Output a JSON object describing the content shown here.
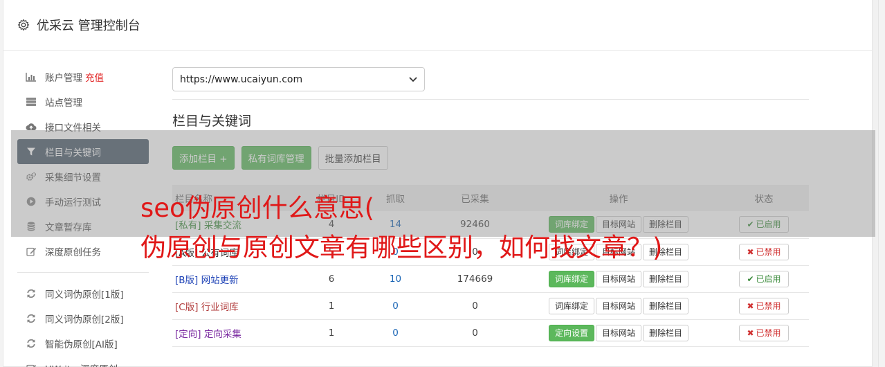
{
  "header": {
    "title": "优采云 管理控制台"
  },
  "sidebar": {
    "items": [
      {
        "label": "账户管理",
        "extra": "充值",
        "icon": "bar-chart-icon"
      },
      {
        "label": "站点管理",
        "icon": "server-icon"
      },
      {
        "label": "接口文件相关",
        "icon": "cloud-upload-icon"
      },
      {
        "label": "栏目与关键词",
        "icon": "filter-icon",
        "active": true
      },
      {
        "label": "采集细节设置",
        "icon": "cogs-icon"
      },
      {
        "label": "手动运行测试",
        "icon": "play-circle-icon"
      },
      {
        "label": "文章暂存库",
        "icon": "database-icon"
      },
      {
        "label": "深度原创任务",
        "icon": "edit-icon"
      }
    ],
    "items2": [
      {
        "label": "同义词伪原创[1版]",
        "icon": "refresh-icon"
      },
      {
        "label": "同义词伪原创[2版]",
        "icon": "refresh-icon"
      },
      {
        "label": "智能伪原创[AI版]",
        "icon": "refresh-icon"
      },
      {
        "label": "UWriter深度原创",
        "icon": "edit-icon"
      }
    ]
  },
  "main": {
    "site_select": "https://www.ucaiyun.com",
    "section_title": "栏目与关键词",
    "buttons": {
      "add": "添加栏目 +",
      "private_lib": "私有词库管理",
      "batch_add": "批量添加栏目"
    },
    "table": {
      "headers": [
        "栏目名称",
        "栏目ID",
        "抓取",
        "已采集",
        "操作",
        "状态"
      ],
      "rows": [
        {
          "tag": "[私有]",
          "name": "采集交流",
          "id": "4",
          "grab": "14",
          "collected": "92460",
          "bind": "词库绑定",
          "bind_green": true,
          "site": "目标网站",
          "del": "删除栏目",
          "status": "已启用",
          "enabled": true,
          "color": "#3a8a3a"
        },
        {
          "tag": "[A版]",
          "name": "公有词库",
          "id": "5",
          "grab": "0",
          "collected": "0",
          "bind": "词库绑定",
          "bind_green": false,
          "site": "目标网站",
          "del": "删除栏目",
          "status": "已禁用",
          "enabled": false,
          "color": "#333333"
        },
        {
          "tag": "[B版]",
          "name": "网站更新",
          "id": "6",
          "grab": "10",
          "collected": "174669",
          "bind": "词库绑定",
          "bind_green": true,
          "site": "目标网站",
          "del": "删除栏目",
          "status": "已启用",
          "enabled": true,
          "color": "#1a3fb5"
        },
        {
          "tag": "[C版]",
          "name": "行业词库",
          "id": "1",
          "grab": "0",
          "collected": "0",
          "bind": "词库绑定",
          "bind_green": false,
          "site": "目标网站",
          "del": "删除栏目",
          "status": "已禁用",
          "enabled": false,
          "color": "#b03a3a"
        },
        {
          "tag": "[定向]",
          "name": "定向采集",
          "id": "1",
          "grab": "0",
          "collected": "0",
          "bind": "定向设置",
          "bind_green": true,
          "site": "目标网站",
          "del": "删除栏目",
          "status": "已禁用",
          "enabled": false,
          "color": "#7a2aa0"
        }
      ]
    }
  },
  "overlay": {
    "line1": "seo伪原创什么意思(",
    "line2": "伪原创与原创文章有哪些区别，如何找文章？)"
  },
  "colors": {
    "active_nav": "#4c5b6b",
    "green": "#5cb85c",
    "red": "#e02020",
    "overlay_text": "#e01818"
  }
}
